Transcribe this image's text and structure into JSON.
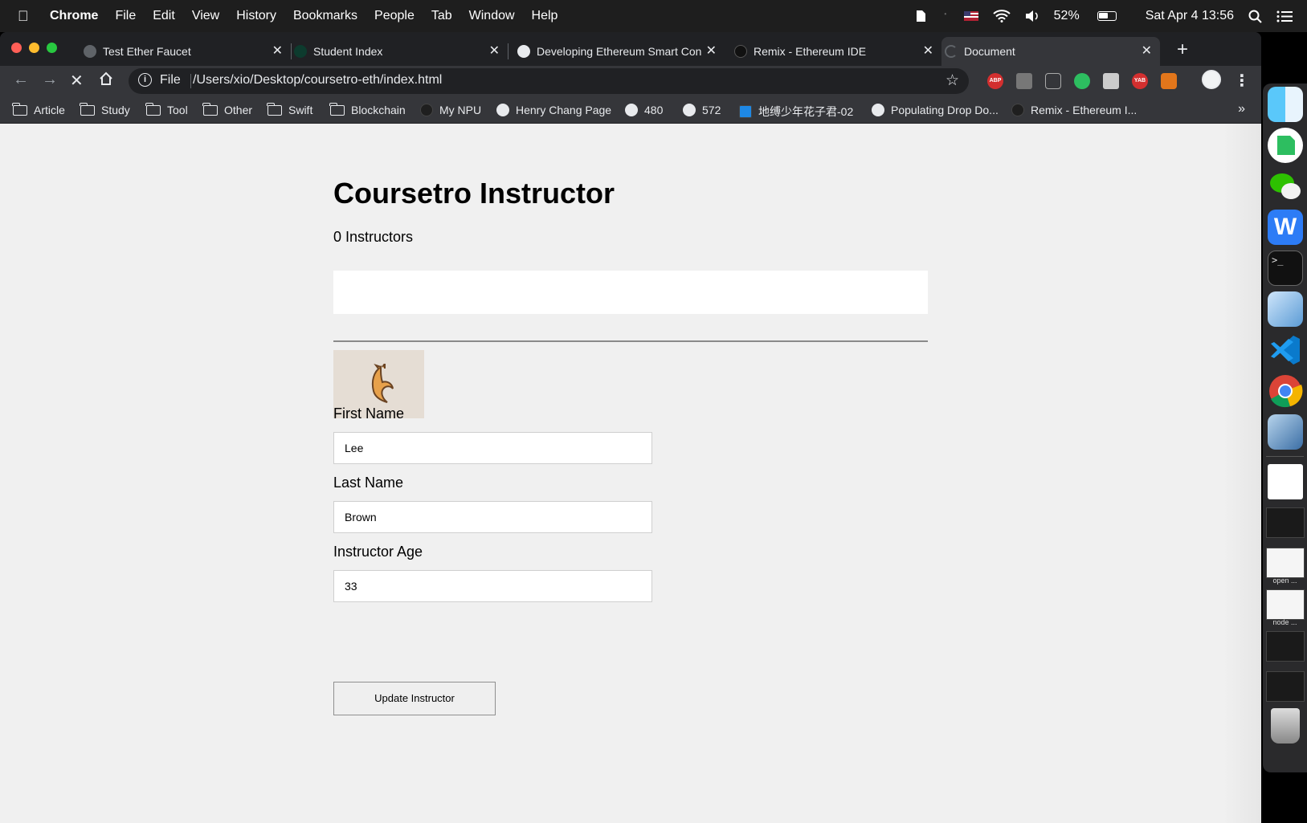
{
  "menubar": {
    "app": "Chrome",
    "items": [
      "File",
      "Edit",
      "View",
      "History",
      "Bookmarks",
      "People",
      "Tab",
      "Window",
      "Help"
    ],
    "battery": "52%",
    "clock": "Sat Apr 4  13:56"
  },
  "tabs": [
    {
      "title": "Test Ether Faucet"
    },
    {
      "title": "Student Index"
    },
    {
      "title": "Developing Ethereum Smart Con"
    },
    {
      "title": "Remix - Ethereum IDE"
    },
    {
      "title": "Document",
      "active": true
    }
  ],
  "omnibox": {
    "scheme": "File",
    "url": "/Users/xio/Desktop/coursetro-eth/index.html"
  },
  "extensions": [
    "ABP",
    "YAB"
  ],
  "bookmarks": [
    {
      "label": "Article",
      "icon": "folder-icon"
    },
    {
      "label": "Study",
      "icon": "folder-icon"
    },
    {
      "label": "Tool",
      "icon": "folder-icon"
    },
    {
      "label": "Other",
      "icon": "folder-icon"
    },
    {
      "label": "Swift",
      "icon": "folder-icon"
    },
    {
      "label": "Blockchain",
      "icon": "folder-icon"
    },
    {
      "label": "My NPU",
      "icon": "site-icon"
    },
    {
      "label": "Henry Chang Page",
      "icon": "globe-icon"
    },
    {
      "label": "480",
      "icon": "globe-icon"
    },
    {
      "label": "572",
      "icon": "globe-icon"
    },
    {
      "label": "地缚少年花子君-02",
      "icon": "video-icon"
    },
    {
      "label": "Populating Drop Do...",
      "icon": "globe-icon"
    },
    {
      "label": "Remix - Ethereum I...",
      "icon": "remix-icon"
    }
  ],
  "bookmarks_more": "»",
  "page": {
    "title": "Coursetro Instructor",
    "count": "0 Instructors",
    "first_name_label": "First Name",
    "first_name_value": "Lee",
    "last_name_label": "Last Name",
    "last_name_value": "Brown",
    "age_label": "Instructor Age",
    "age_value": "33",
    "button": "Update Instructor"
  },
  "dock": {
    "captions": [
      "open ...",
      "node ..."
    ]
  },
  "colors": {
    "page_bg": "#f0f0f0",
    "chrome_dark": "#202124",
    "chrome_toolbar": "#35363a",
    "traffic_red": "#ff5f57",
    "traffic_yellow": "#febc2e",
    "traffic_green": "#28c840"
  }
}
